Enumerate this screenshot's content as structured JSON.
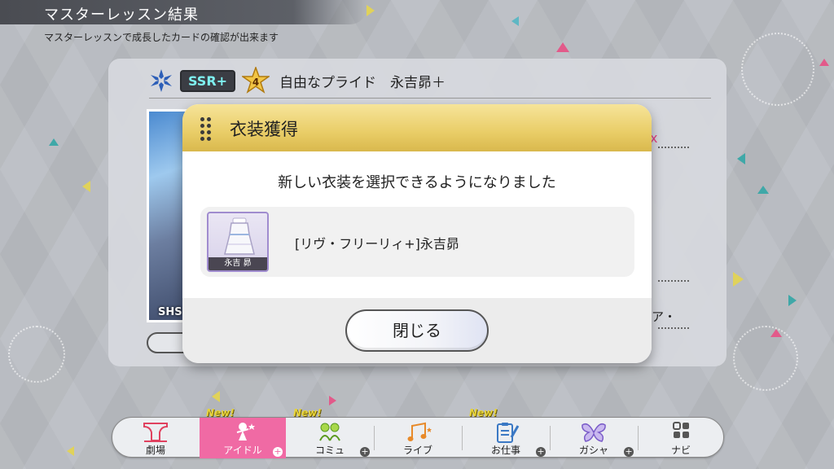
{
  "header": {
    "title": "マスターレッスン結果",
    "subtitle": "マスターレッスンで成長したカードの確認が出来ます"
  },
  "card": {
    "rarity": "SSR+",
    "level": "4",
    "name": "自由なプライド　永吉昴＋",
    "art_label": "SHS",
    "side_text": "ア・",
    "side_mark": "x"
  },
  "modal": {
    "title": "衣装獲得",
    "message": "新しい衣装を選択できるようになりました",
    "item": {
      "thumb_label": "永吉 昴",
      "name": "[リヴ・フリーリィ+]永吉昴"
    },
    "close_label": "閉じる"
  },
  "nav": {
    "items": [
      {
        "label": "劇場",
        "new": false,
        "plus": false,
        "active": false,
        "icon": "theater-icon"
      },
      {
        "label": "アイドル",
        "new": true,
        "plus": true,
        "active": true,
        "icon": "idol-icon"
      },
      {
        "label": "コミュ",
        "new": true,
        "plus": true,
        "active": false,
        "icon": "commu-icon"
      },
      {
        "label": "ライブ",
        "new": false,
        "plus": false,
        "active": false,
        "icon": "music-icon"
      },
      {
        "label": "お仕事",
        "new": true,
        "plus": true,
        "active": false,
        "icon": "work-icon"
      },
      {
        "label": "ガシャ",
        "new": false,
        "plus": true,
        "active": false,
        "icon": "butterfly-icon"
      },
      {
        "label": "ナビ",
        "new": false,
        "plus": false,
        "active": false,
        "icon": "grid-icon"
      }
    ],
    "new_badge": "New!",
    "plus_glyph": "+"
  },
  "colors": {
    "accent_pink": "#f06aa4",
    "modal_header_gold": "#e9cd67",
    "rarity_cyan": "#7ef0f0"
  }
}
